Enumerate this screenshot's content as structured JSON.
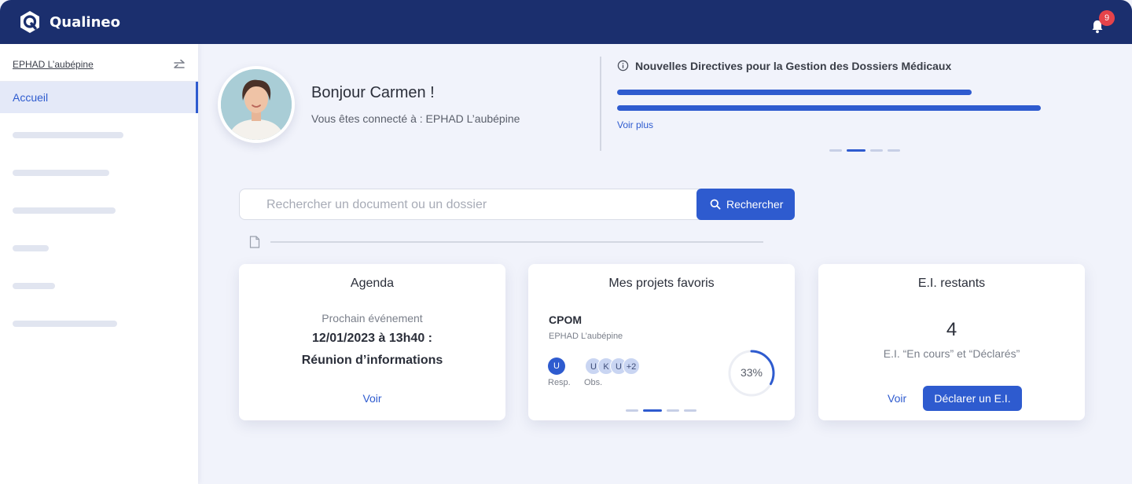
{
  "app": {
    "name": "Qualineo"
  },
  "notifications": {
    "count": "9"
  },
  "sidebar": {
    "org_name": "EPHAD L’aubépine",
    "active_item": "Accueil"
  },
  "welcome": {
    "greeting": "Bonjour Carmen !",
    "connected_text": "Vous êtes connecté à : EPHAD L’aubépine"
  },
  "news": {
    "title": "Nouvelles Directives pour la Gestion des Dossiers Médicaux",
    "more_label": "Voir plus"
  },
  "search": {
    "placeholder": "Rechercher un document ou un dossier",
    "value": "",
    "button_label": "Rechercher"
  },
  "agenda": {
    "title": "Agenda",
    "subtitle": "Prochain événement",
    "event_date": "12/01/2023 à 13h40 :",
    "event_name": "Réunion d’informations",
    "link": "Voir"
  },
  "projects": {
    "title": "Mes projets favoris",
    "project_name": "CPOM",
    "project_org": "EPHAD L’aubépine",
    "resp_initial": "U",
    "resp_label": "Resp.",
    "observers": [
      "U",
      "K",
      "U",
      "+2"
    ],
    "obs_label": "Obs.",
    "progress_text": "33%",
    "progress_fraction": 0.33
  },
  "incidents": {
    "title": "E.I. restants",
    "count": "4",
    "description": "E.I. “En cours” et “Déclarés”",
    "link": "Voir",
    "button_label": "Déclarer un E.I."
  },
  "colors": {
    "primary": "#2e5bcf",
    "topbar": "#1b2f6e",
    "badge": "#e5434a",
    "background": "#f1f3fb"
  },
  "icons": [
    "qualineo-logo-icon",
    "bell-icon",
    "switch-icon",
    "info-icon",
    "search-icon",
    "document-icon"
  ]
}
